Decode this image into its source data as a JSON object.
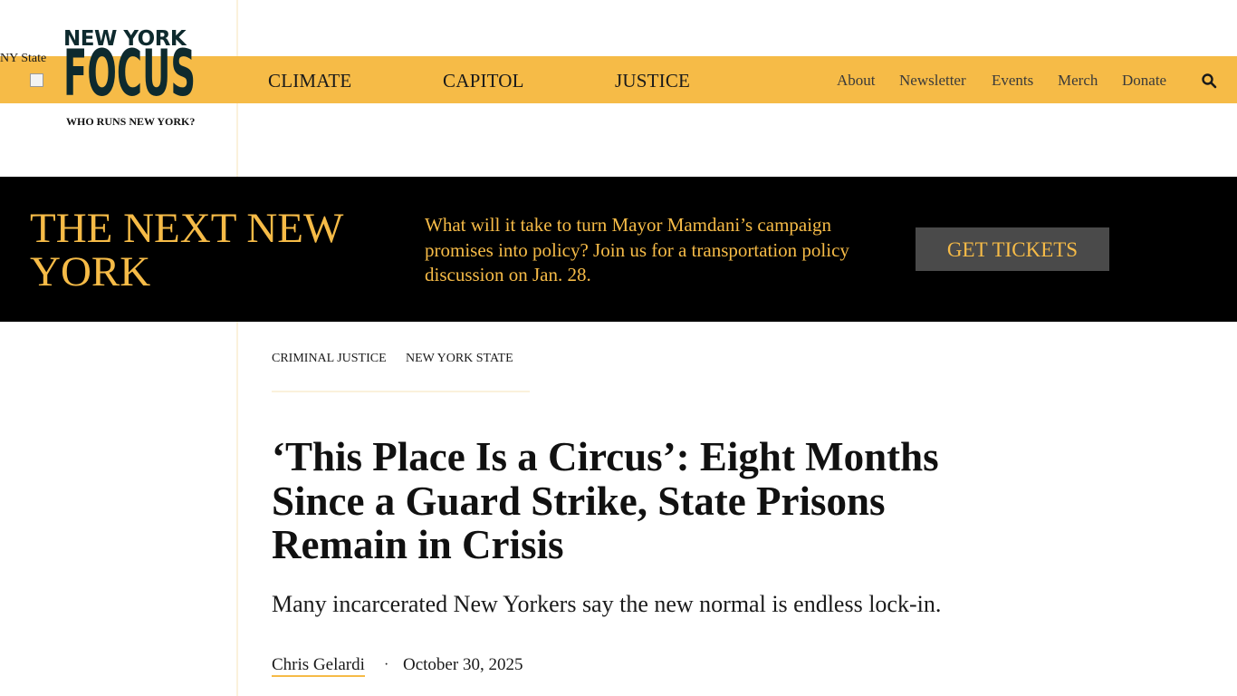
{
  "site": {
    "logo_top": "NEW YORK",
    "logo_word": "FOCUS",
    "logo_tagline": "WHO RUNS NEW YORK?",
    "broken_image_alt": "NY State"
  },
  "nav": {
    "main": [
      "CLIMATE",
      "CAPITOL",
      "JUSTICE"
    ],
    "secondary": [
      "About",
      "Newsletter",
      "Events",
      "Merch",
      "Donate"
    ],
    "search_icon": "search-icon"
  },
  "banner": {
    "title": "THE NEXT NEW YORK",
    "text": "What will it take to turn Mayor Mamdani’s campaign promises into policy? Join us for a transportation policy discussion on Jan. 28.",
    "button": "GET TICKETS"
  },
  "article": {
    "tags": [
      "CRIMINAL JUSTICE",
      "NEW YORK STATE"
    ],
    "headline": "‘This Place Is a Circus’: Eight Months Since a Guard Strike, State Prisons Remain in Crisis",
    "dek": "Many incarcerated New Yorkers say the new normal is endless lock-in.",
    "author": "Chris Gelardi",
    "separator": "·",
    "date": "October 30, 2025"
  },
  "colors": {
    "accent": "#f6bb47",
    "banner_bg": "#000000",
    "button_bg": "#4a4a4a",
    "logo": "#0e2a2e",
    "divider": "#fbf1dc"
  }
}
